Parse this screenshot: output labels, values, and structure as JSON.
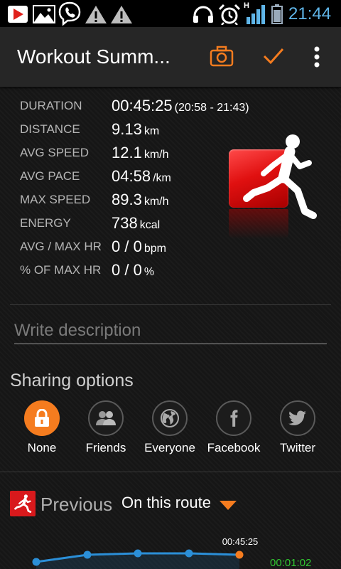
{
  "status_bar": {
    "left_icons": [
      "youtube-icon",
      "gallery-icon",
      "viber-icon",
      "warning-icon",
      "warning-icon"
    ],
    "right_icons": [
      "headset-icon",
      "alarm-icon",
      "signal-icon",
      "battery-icon"
    ],
    "network_type": "H",
    "time": "21:44"
  },
  "action_bar": {
    "title": "Workout Summ...",
    "actions": [
      "camera-icon",
      "check-icon",
      "overflow-menu-icon"
    ]
  },
  "stats": {
    "rows": [
      {
        "label": "DURATION",
        "value": "00:45:25",
        "unit": "(20:58 - 21:43)"
      },
      {
        "label": "DISTANCE",
        "value": "9.13",
        "unit": "km"
      },
      {
        "label": "AVG SPEED",
        "value": "12.1",
        "unit": "km/h"
      },
      {
        "label": "AVG PACE",
        "value": "04:58",
        "unit": "/km"
      },
      {
        "label": "MAX SPEED",
        "value": "89.3",
        "unit": "km/h"
      },
      {
        "label": "ENERGY",
        "value": "738",
        "unit": "kcal"
      },
      {
        "label": "AVG / MAX HR",
        "value": "0 / 0",
        "unit": "bpm"
      },
      {
        "label": "% OF MAX HR",
        "value": "0 / 0",
        "unit": "%"
      }
    ],
    "sport_icon": "running-icon"
  },
  "description": {
    "placeholder": "Write description"
  },
  "sharing": {
    "heading": "Sharing options",
    "options": [
      {
        "label": "None",
        "icon": "lock-icon",
        "selected": true
      },
      {
        "label": "Friends",
        "icon": "friends-icon",
        "selected": false
      },
      {
        "label": "Everyone",
        "icon": "globe-icon",
        "selected": false
      },
      {
        "label": "Facebook",
        "icon": "facebook-icon",
        "selected": false
      },
      {
        "label": "Twitter",
        "icon": "twitter-icon",
        "selected": false
      }
    ]
  },
  "previous": {
    "label": "Previous",
    "filter": "On this route",
    "icon": "running-icon"
  },
  "route_chart": {
    "point_label": "00:45:25",
    "side_value": "00:01:02"
  },
  "colors": {
    "accent": "#f57c1f",
    "status_time": "#5fb5e8",
    "chart_line": "#2b8fd8",
    "chart_side": "#31c731",
    "brand_red": "#d8191c"
  }
}
